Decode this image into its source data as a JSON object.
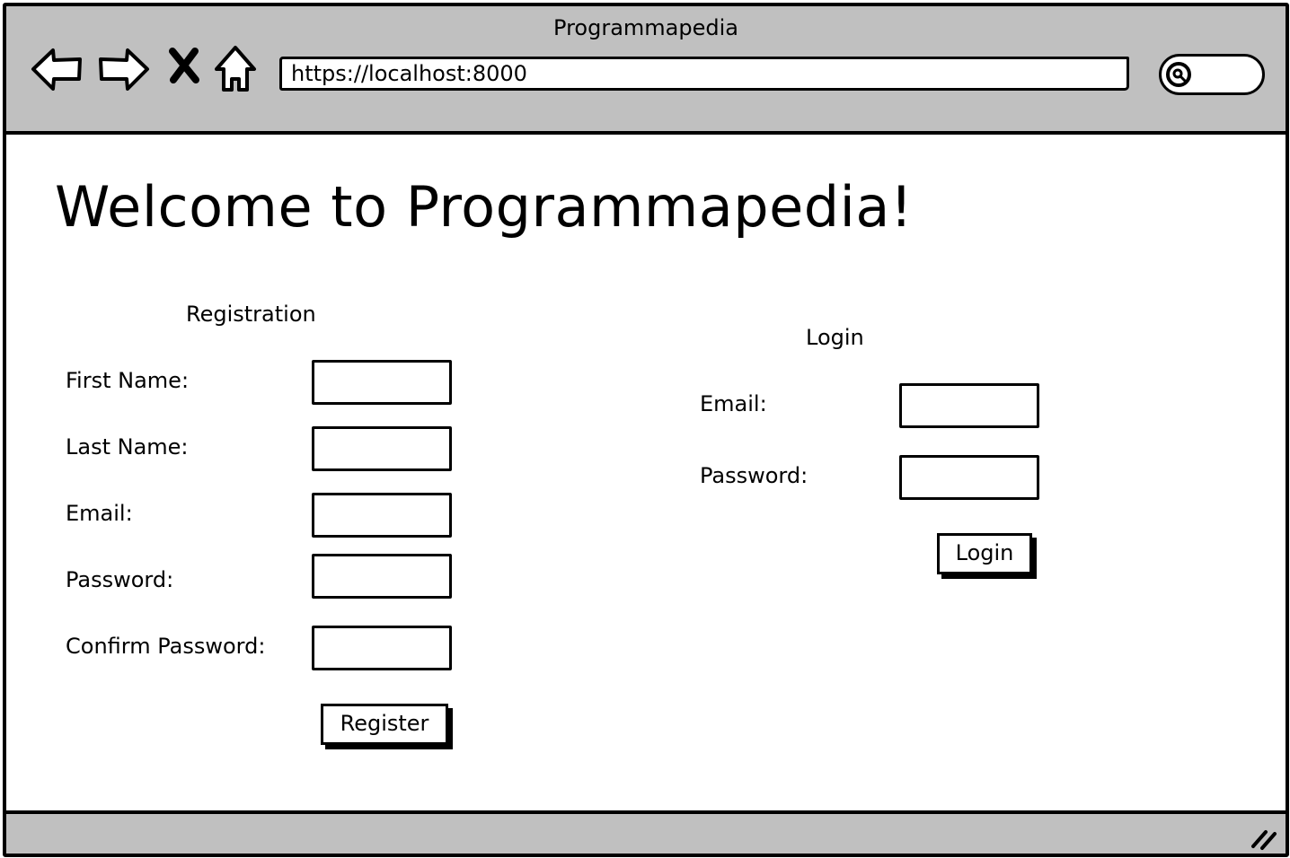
{
  "window": {
    "title": "Programmapedia"
  },
  "browser": {
    "url": "https://localhost:8000",
    "nav_icons": [
      "back-arrow-icon",
      "forward-arrow-icon",
      "close-x-icon",
      "home-icon",
      "search-icon"
    ]
  },
  "page": {
    "heading": "Welcome to Programmapedia!"
  },
  "registration": {
    "title": "Registration",
    "fields": {
      "first_name": {
        "label": "First Name:",
        "value": ""
      },
      "last_name": {
        "label": "Last Name:",
        "value": ""
      },
      "email": {
        "label": "Email:",
        "value": ""
      },
      "password": {
        "label": "Password:",
        "value": ""
      },
      "confirm_password": {
        "label": "Confirm Password:",
        "value": ""
      }
    },
    "submit_label": "Register"
  },
  "login": {
    "title": "Login",
    "fields": {
      "email": {
        "label": "Email:",
        "value": ""
      },
      "password": {
        "label": "Password:",
        "value": ""
      }
    },
    "submit_label": "Login"
  },
  "colors": {
    "chrome": "#c0c0c0",
    "background": "#ffffff",
    "ink": "#000000"
  }
}
